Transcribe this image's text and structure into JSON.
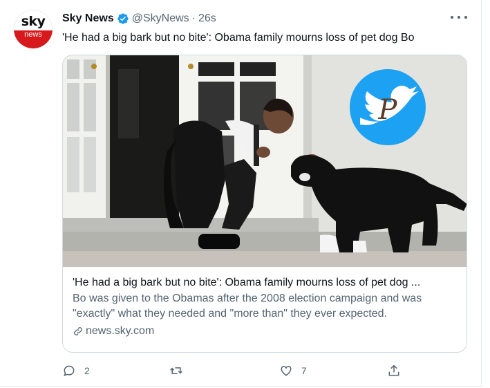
{
  "tweet": {
    "author_name": "Sky News",
    "handle": "@SkyNews",
    "separator": "·",
    "timestamp": "26s",
    "text": "'He had a big bark but no bite': Obama family mourns loss of pet dog Bo",
    "avatar": {
      "brand_top": "sky",
      "brand_bottom": "news",
      "brand_color": "#d7191c"
    },
    "verified_icon": "verified-badge-icon",
    "more_icon": "more-options-icon"
  },
  "card": {
    "image_desc_icon": "news-photo",
    "watermark_icon": "twitter-bird-logo",
    "watermark_color": "#1da1f2",
    "title": "'He had a big bark but no bite': Obama family mourns loss of pet dog ...",
    "description": "Bo was given to the Obamas after the 2008 election campaign and was \"exactly\" what they needed and \"more than\" they ever expected.",
    "domain": "news.sky.com",
    "link_icon": "link-icon"
  },
  "actions": {
    "reply": {
      "icon": "reply-icon",
      "count": "2"
    },
    "retweet": {
      "icon": "retweet-icon",
      "count": ""
    },
    "like": {
      "icon": "heart-icon",
      "count": "7"
    },
    "share": {
      "icon": "share-icon",
      "count": ""
    }
  },
  "colors": {
    "text_primary": "#0f1419",
    "text_secondary": "#536471",
    "verified": "#1d9bf0",
    "border": "#cfd9de"
  }
}
